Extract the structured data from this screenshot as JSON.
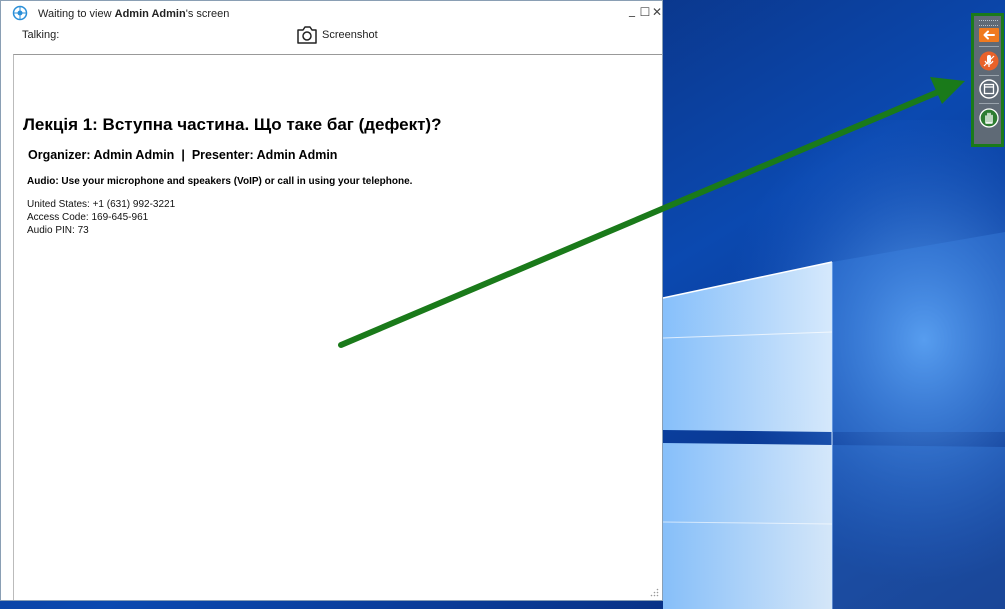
{
  "window": {
    "title_prefix": "Waiting to view ",
    "title_name": "Admin Admin",
    "title_suffix": "'s screen",
    "minimize_glyph": "_",
    "maximize_glyph": "☐",
    "close_glyph": "✕"
  },
  "header": {
    "talking_label": "Talking:",
    "screenshot_label": "Screenshot"
  },
  "content": {
    "lecture_title": "Лекція 1: Вступна частина. Що таке баг (дефект)?",
    "organizer_text": "Organizer: Admin Admin",
    "separator": "|",
    "presenter_text": "Presenter: Admin Admin",
    "audio_text": "Audio: Use your microphone and speakers (VoIP) or call in using your telephone.",
    "dial_in": [
      "United States: +1 (631) 992-3221",
      "Access Code: 169-645-961",
      "Audio PIN: 73"
    ]
  },
  "toolbar": {
    "buttons": [
      "arrow-left-icon",
      "microphone-icon",
      "window-icon",
      "hand-raise-icon"
    ]
  },
  "colors": {
    "desktop_blue": "#0b3a8f",
    "toolbar_bg": "#5f6a76",
    "highlight_green": "#1a7a1a",
    "mic_orange": "#e8622a"
  }
}
